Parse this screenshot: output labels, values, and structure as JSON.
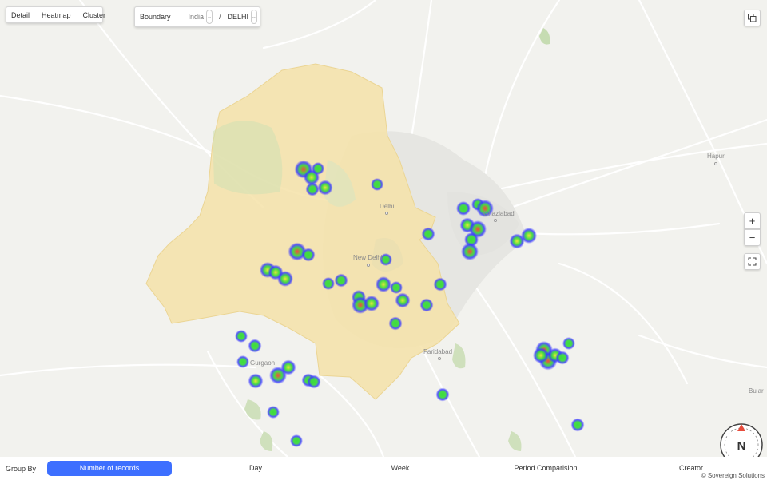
{
  "view_modes": [
    "Detail",
    "Heatmap",
    "Cluster"
  ],
  "boundary": {
    "label": "Boundary",
    "country": "India",
    "state": "DELHI",
    "separator": "/"
  },
  "map_labels": {
    "delhi": "Delhi",
    "new_delhi": "New Delhi",
    "ghaziabad": "Ghaziabad",
    "gurgaon": "Gurgaon",
    "faridabad": "Faridabad",
    "hapur": "Hapur",
    "bulandshahr": "Bular"
  },
  "map_controls": {
    "zoom_in": "+",
    "zoom_out": "−",
    "compass": "N"
  },
  "bottom_bar": {
    "group_by_label": "Group By",
    "options": [
      "Number of records",
      "Day",
      "Week",
      "Period Comparision",
      "Creator"
    ],
    "selected": "Number of records"
  },
  "copyright": "© Sovereign Solutions",
  "colors": {
    "boundary_fill": "#f5e2a8",
    "accent": "#3d6fff",
    "heat_low": "#3a3aff",
    "heat_mid": "#3ddc3d",
    "heat_high": "#ff4040"
  }
}
